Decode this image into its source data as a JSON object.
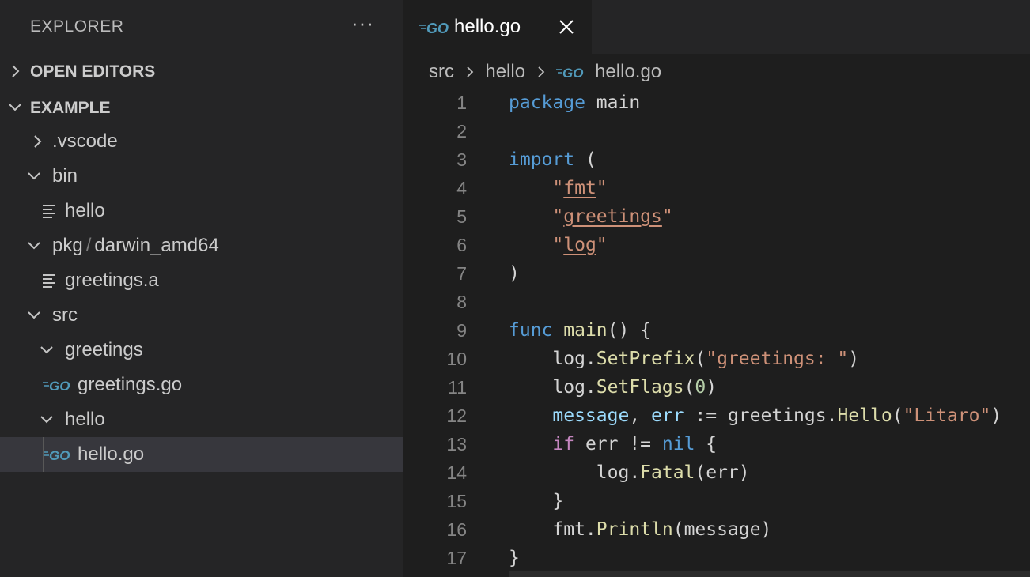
{
  "sidebar": {
    "title": "EXPLORER",
    "more_label": "···",
    "sections": [
      {
        "label": "OPEN EDITORS",
        "expanded": false
      },
      {
        "label": "EXAMPLE",
        "expanded": true
      }
    ],
    "tree": [
      {
        "label": ".vscode",
        "kind": "folder",
        "expanded": false
      },
      {
        "label": "bin",
        "kind": "folder",
        "expanded": true
      },
      {
        "label": "hello",
        "kind": "file",
        "icon": "text-file-icon"
      },
      {
        "label": "pkg",
        "label2": "darwin_amd64",
        "kind": "folder",
        "expanded": true
      },
      {
        "label": "greetings.a",
        "kind": "file",
        "icon": "text-file-icon"
      },
      {
        "label": "src",
        "kind": "folder",
        "expanded": true
      },
      {
        "label": "greetings",
        "kind": "folder",
        "expanded": true
      },
      {
        "label": "greetings.go",
        "kind": "file",
        "icon": "go-file-icon"
      },
      {
        "label": "hello",
        "kind": "folder",
        "expanded": true
      },
      {
        "label": "hello.go",
        "kind": "file",
        "icon": "go-file-icon",
        "selected": true
      }
    ]
  },
  "editor": {
    "tab": {
      "label": "hello.go",
      "icon": "go-file-icon",
      "active": true
    },
    "breadcrumb": [
      "src",
      "hello",
      "hello.go"
    ],
    "lines": [
      {
        "n": "1",
        "tokens": [
          [
            "kw",
            "package"
          ],
          [
            "pl",
            " main"
          ]
        ]
      },
      {
        "n": "2",
        "tokens": []
      },
      {
        "n": "3",
        "tokens": [
          [
            "kw",
            "import"
          ],
          [
            "pl",
            " ("
          ]
        ]
      },
      {
        "n": "4",
        "tokens": [
          [
            "pl",
            "    "
          ],
          [
            "str",
            "\""
          ],
          [
            "strul",
            "fmt"
          ],
          [
            "str",
            "\""
          ]
        ]
      },
      {
        "n": "5",
        "tokens": [
          [
            "pl",
            "    "
          ],
          [
            "str",
            "\""
          ],
          [
            "strul",
            "greetings"
          ],
          [
            "str",
            "\""
          ]
        ]
      },
      {
        "n": "6",
        "tokens": [
          [
            "pl",
            "    "
          ],
          [
            "str",
            "\""
          ],
          [
            "strul",
            "log"
          ],
          [
            "str",
            "\""
          ]
        ]
      },
      {
        "n": "7",
        "tokens": [
          [
            "pl",
            ")"
          ]
        ]
      },
      {
        "n": "8",
        "tokens": []
      },
      {
        "n": "9",
        "tokens": [
          [
            "kw",
            "func"
          ],
          [
            "pl",
            " "
          ],
          [
            "fn",
            "main"
          ],
          [
            "pl",
            "() {"
          ]
        ]
      },
      {
        "n": "10",
        "tokens": [
          [
            "pl",
            "    log."
          ],
          [
            "fn",
            "SetPrefix"
          ],
          [
            "pl",
            "("
          ],
          [
            "str",
            "\"greetings: \""
          ],
          [
            "pl",
            ")"
          ]
        ]
      },
      {
        "n": "11",
        "tokens": [
          [
            "pl",
            "    log."
          ],
          [
            "fn",
            "SetFlags"
          ],
          [
            "pl",
            "("
          ],
          [
            "num",
            "0"
          ],
          [
            "pl",
            ")"
          ]
        ]
      },
      {
        "n": "12",
        "tokens": [
          [
            "pl",
            "    "
          ],
          [
            "var",
            "message"
          ],
          [
            "pl",
            ", "
          ],
          [
            "var",
            "err"
          ],
          [
            "pl",
            " := greetings."
          ],
          [
            "fn",
            "Hello"
          ],
          [
            "pl",
            "("
          ],
          [
            "str",
            "\"Litaro\""
          ],
          [
            "pl",
            ")"
          ]
        ]
      },
      {
        "n": "13",
        "tokens": [
          [
            "pl",
            "    "
          ],
          [
            "kw2",
            "if"
          ],
          [
            "pl",
            " err != "
          ],
          [
            "kw",
            "nil"
          ],
          [
            "pl",
            " {"
          ]
        ]
      },
      {
        "n": "14",
        "tokens": [
          [
            "pl",
            "        log."
          ],
          [
            "fn",
            "Fatal"
          ],
          [
            "pl",
            "(err)"
          ]
        ]
      },
      {
        "n": "15",
        "tokens": [
          [
            "pl",
            "    }"
          ]
        ]
      },
      {
        "n": "16",
        "tokens": [
          [
            "pl",
            "    fmt."
          ],
          [
            "fn",
            "Println"
          ],
          [
            "pl",
            "(message)"
          ]
        ]
      },
      {
        "n": "17",
        "tokens": [
          [
            "pl",
            "}"
          ]
        ]
      }
    ]
  },
  "colors": {
    "sidebar_bg": "#252526",
    "editor_bg": "#1e1e1e",
    "selected_row": "#37373d",
    "go_icon": "#519aba",
    "keyword": "#569cd6",
    "control_keyword": "#c586c0",
    "string": "#ce9178",
    "function": "#dcdcaa",
    "variable": "#9cdcfe",
    "number": "#b5cea8"
  }
}
